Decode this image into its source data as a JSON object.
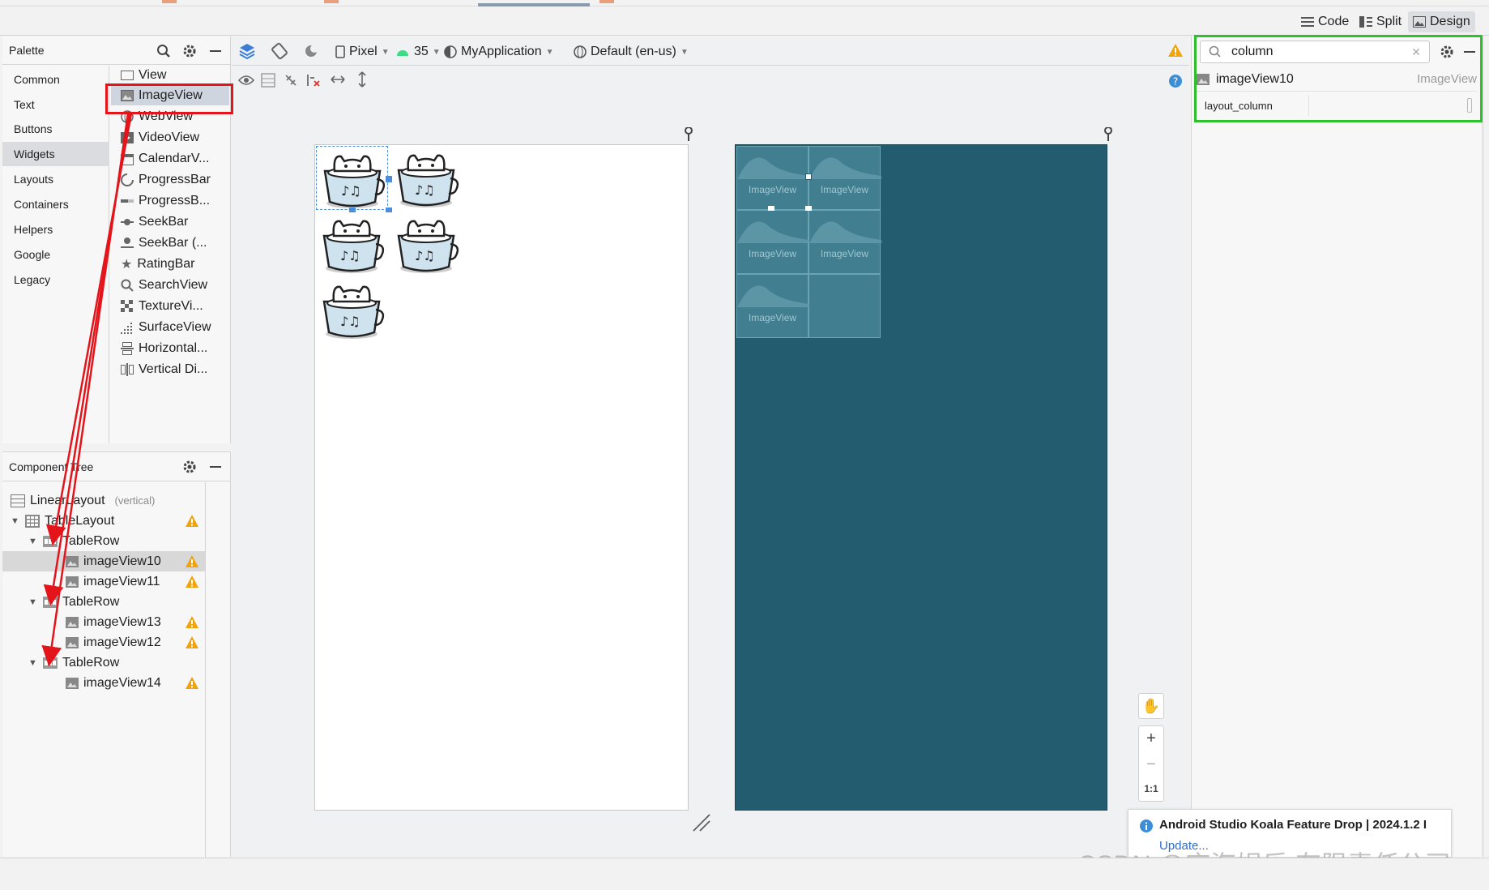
{
  "mode_bar": {
    "code_label": "Code",
    "split_label": "Split",
    "design_label": "Design"
  },
  "palette": {
    "title": "Palette",
    "categories": [
      "Common",
      "Text",
      "Buttons",
      "Widgets",
      "Layouts",
      "Containers",
      "Helpers",
      "Google",
      "Legacy"
    ],
    "selected_category": "Widgets",
    "items": [
      "View",
      "ImageView",
      "WebView",
      "VideoView",
      "CalendarV...",
      "ProgressBar",
      "ProgressB...",
      "SeekBar",
      "SeekBar (...",
      "RatingBar",
      "SearchView",
      "TextureVi...",
      "SurfaceView",
      "Horizontal...",
      "Vertical Di..."
    ],
    "selected_item": "ImageView"
  },
  "component_tree": {
    "title": "Component Tree",
    "rows": [
      {
        "label": "LinearLayout",
        "hint": "(vertical)"
      },
      {
        "label": "TableLayout"
      },
      {
        "label": "TableRow"
      },
      {
        "label": "imageView10"
      },
      {
        "label": "imageView11"
      },
      {
        "label": "TableRow"
      },
      {
        "label": "imageView13"
      },
      {
        "label": "imageView12"
      },
      {
        "label": "TableRow"
      },
      {
        "label": "imageView14"
      }
    ]
  },
  "design_toolbar": {
    "device": "Pixel",
    "api_level": "35",
    "theme": "MyApplication",
    "locale": "Default (en-us)"
  },
  "blueprint": {
    "placeholder_label": "ImageView"
  },
  "attributes": {
    "search_value": "column",
    "component_name": "imageView10",
    "component_type": "ImageView",
    "attribute_name": "layout_column"
  },
  "notification": {
    "title": "Android Studio Koala Feature Drop | 2024.1.2 I",
    "link": "Update..."
  },
  "watermark": "CSDN @庆海娱乐 有限责任公司",
  "zoom": {
    "fit_label": "1:1"
  },
  "colors": {
    "highlight_red": "#e4141b",
    "highlight_green": "#2ec12e",
    "blueprint_bg": "#235c6e",
    "warning": "#f0a30a"
  }
}
